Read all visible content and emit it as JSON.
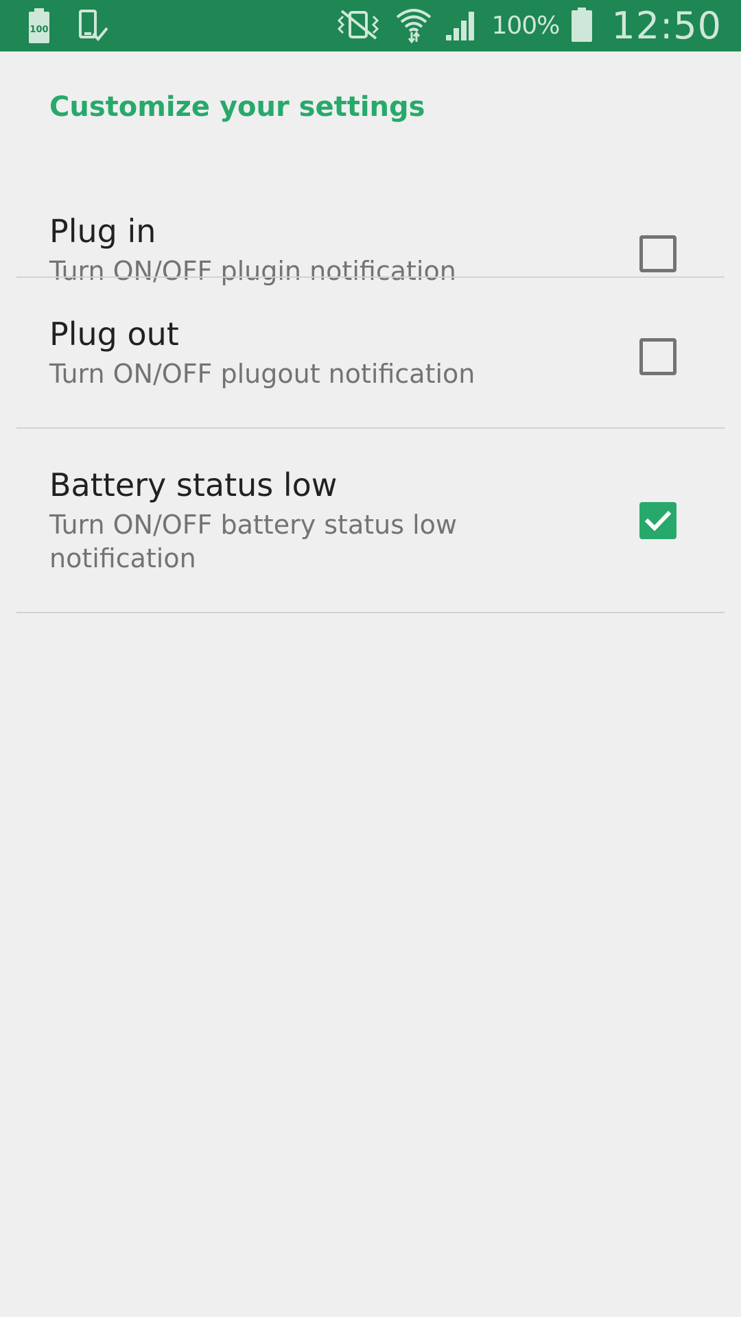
{
  "status_bar": {
    "battery_percent": "100%",
    "clock": "12:50",
    "notification_battery_level": "100",
    "icons": [
      "battery-notification-icon",
      "device-check-icon",
      "vibrate-icon",
      "wifi-icon",
      "signal-icon",
      "battery-icon"
    ]
  },
  "header": {
    "title": "Customize your settings"
  },
  "preferences": [
    {
      "title": "Plug in",
      "summary": "Turn ON/OFF plugin notification",
      "checked": false
    },
    {
      "title": "Plug out",
      "summary": "Turn ON/OFF plugout notification",
      "checked": false
    },
    {
      "title": "Battery status low",
      "summary": "Turn ON/OFF battery status low notification",
      "checked": true
    }
  ],
  "colors": {
    "status_bar": "#1e8753",
    "accent": "#27a96b",
    "background": "#efefef"
  }
}
